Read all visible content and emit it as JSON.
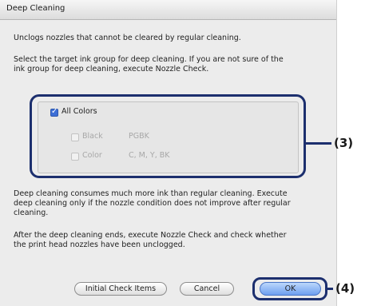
{
  "dialog": {
    "title": "Deep Cleaning",
    "intro": "Unclogs nozzles that cannot be cleared by regular cleaning.",
    "instruction_line1": "Select the target ink group for deep cleaning. If you are not sure of the",
    "instruction_line2": "ink group for deep cleaning, execute Nozzle Check.",
    "ink_group": {
      "all_colors": {
        "label": "All Colors",
        "checked": true
      },
      "options": [
        {
          "name": "Black",
          "inks": "PGBK",
          "checked": false,
          "enabled": false
        },
        {
          "name": "Color",
          "inks": "C, M, Y, BK",
          "checked": false,
          "enabled": false
        }
      ]
    },
    "warning_line1": "Deep cleaning consumes much more ink than regular cleaning. Execute",
    "warning_line2": "deep cleaning only if the nozzle condition does not improve after regular",
    "warning_line3": "cleaning.",
    "after_line1": "After the deep cleaning ends, execute Nozzle Check and check whether",
    "after_line2": "the print head nozzles have been unclogged.",
    "buttons": {
      "initial_check_items": "Initial Check Items",
      "cancel": "Cancel",
      "ok": "OK"
    }
  },
  "callouts": {
    "ink_group": "(3)",
    "ok_button": "(4)"
  },
  "colors": {
    "callout_frame": "#1c2f6e",
    "dialog_background": "#ececec",
    "default_button": "#6e9ff0"
  }
}
